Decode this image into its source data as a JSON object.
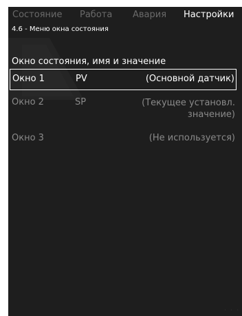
{
  "tabs": [
    {
      "label": "Состояние",
      "active": false
    },
    {
      "label": "Работа",
      "active": false
    },
    {
      "label": "Авария",
      "active": false
    },
    {
      "label": "Настройки",
      "active": true
    }
  ],
  "breadcrumb": "4.6 - Меню окна состояния",
  "section_title": "Окно состояния, имя и значение",
  "rows": [
    {
      "window": "Окно 1",
      "name": "PV",
      "value": "(Основной датчик)",
      "selected": true
    },
    {
      "window": "Окно 2",
      "name": "SP",
      "value_line1": "(Текущее установл.",
      "value_line2": "значение)",
      "selected": false
    },
    {
      "window": "Окно 3",
      "name": "",
      "value": "(Не используется)",
      "selected": false
    }
  ],
  "colors": {
    "background": "#1e1e1e",
    "text_active": "#ffffff",
    "text_inactive": "#8a8a8a",
    "tab_inactive": "#6a6a6a"
  },
  "footer_dots": "· · ·"
}
